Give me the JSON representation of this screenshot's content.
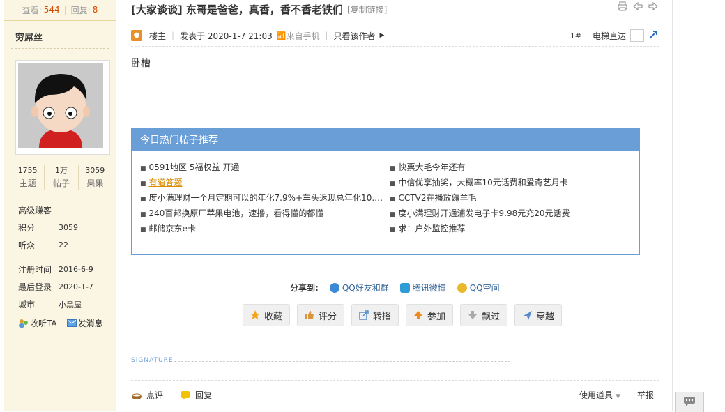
{
  "user": {
    "views_label": "查看:",
    "views": "544",
    "replies_label": "回复:",
    "replies": "8",
    "name": "穷屌丝",
    "stats": [
      {
        "value": "1755",
        "label": "主题"
      },
      {
        "value": "1万",
        "label": "帖子"
      },
      {
        "value": "3059",
        "label": "果果"
      }
    ],
    "rank": "高级赚客",
    "fields": [
      {
        "key": "积分",
        "value": "3059"
      },
      {
        "key": "听众",
        "value": "22"
      },
      {
        "key": "注册时间",
        "value": "2016-6-9"
      },
      {
        "key": "最后登录",
        "value": "2020-1-7"
      },
      {
        "key": "城市",
        "value": "小黑屋"
      }
    ],
    "follow_label": "收听TA",
    "message_label": "发消息"
  },
  "post": {
    "title": "[大家谈谈] 东哥是爸爸，真香，香不香老铁们",
    "copy_link": "[复制链接]",
    "author_role": "楼主",
    "posted": "发表于 2020-1-7 21:03",
    "from_mobile": "来自手机",
    "only_author": "只看该作者",
    "floor": "1#",
    "elevator": "电梯直达",
    "content": "卧槽"
  },
  "hot": {
    "title": "今日热门帖子推荐",
    "left": [
      {
        "text": "0591地区 5福权益 开通",
        "highlight": false
      },
      {
        "text": "有道答题",
        "highlight": true
      },
      {
        "text": "度小满理财一个月定期可以的年化7.9%+车头返现总年化10.5...",
        "highlight": false
      },
      {
        "text": "240百邦换原厂苹果电池，速撸，看得懂的都懂",
        "highlight": false
      },
      {
        "text": "邮储京东e卡",
        "highlight": false
      }
    ],
    "right": [
      {
        "text": "快票大毛今年还有",
        "highlight": false
      },
      {
        "text": "中信优享抽奖，大概率10元话费和爱奇艺月卡",
        "highlight": false
      },
      {
        "text": "CCTV2在播放薅羊毛",
        "highlight": false
      },
      {
        "text": "度小满理财开通浦发电子卡9.98元充20元话费",
        "highlight": false
      },
      {
        "text": "求：户外监控推荐",
        "highlight": false
      }
    ]
  },
  "share": {
    "label": "分享到:",
    "items": [
      {
        "text": "QQ好友和群",
        "color": "#3a8ad6"
      },
      {
        "text": "腾讯微博",
        "color": "#2f9bd7"
      },
      {
        "text": "QQ空间",
        "color": "#e9b92c"
      }
    ]
  },
  "buttons": [
    {
      "label": "收藏",
      "icon": "star-icon",
      "color": "#f2a516"
    },
    {
      "label": "评分",
      "icon": "thumb-icon",
      "color": "#d9963c"
    },
    {
      "label": "转播",
      "icon": "repost-icon",
      "color": "#5a8bc8"
    },
    {
      "label": "参加",
      "icon": "up-arrow-icon",
      "color": "#f28a1a"
    },
    {
      "label": "飘过",
      "icon": "down-arrow-icon",
      "color": "#aaaaaa"
    },
    {
      "label": "穿越",
      "icon": "plane-icon",
      "color": "#5a8bc8"
    }
  ],
  "signature": "SIGNATURE",
  "footer": {
    "comment": "点评",
    "reply": "回复",
    "tools": "使用道具",
    "report": "举报"
  }
}
